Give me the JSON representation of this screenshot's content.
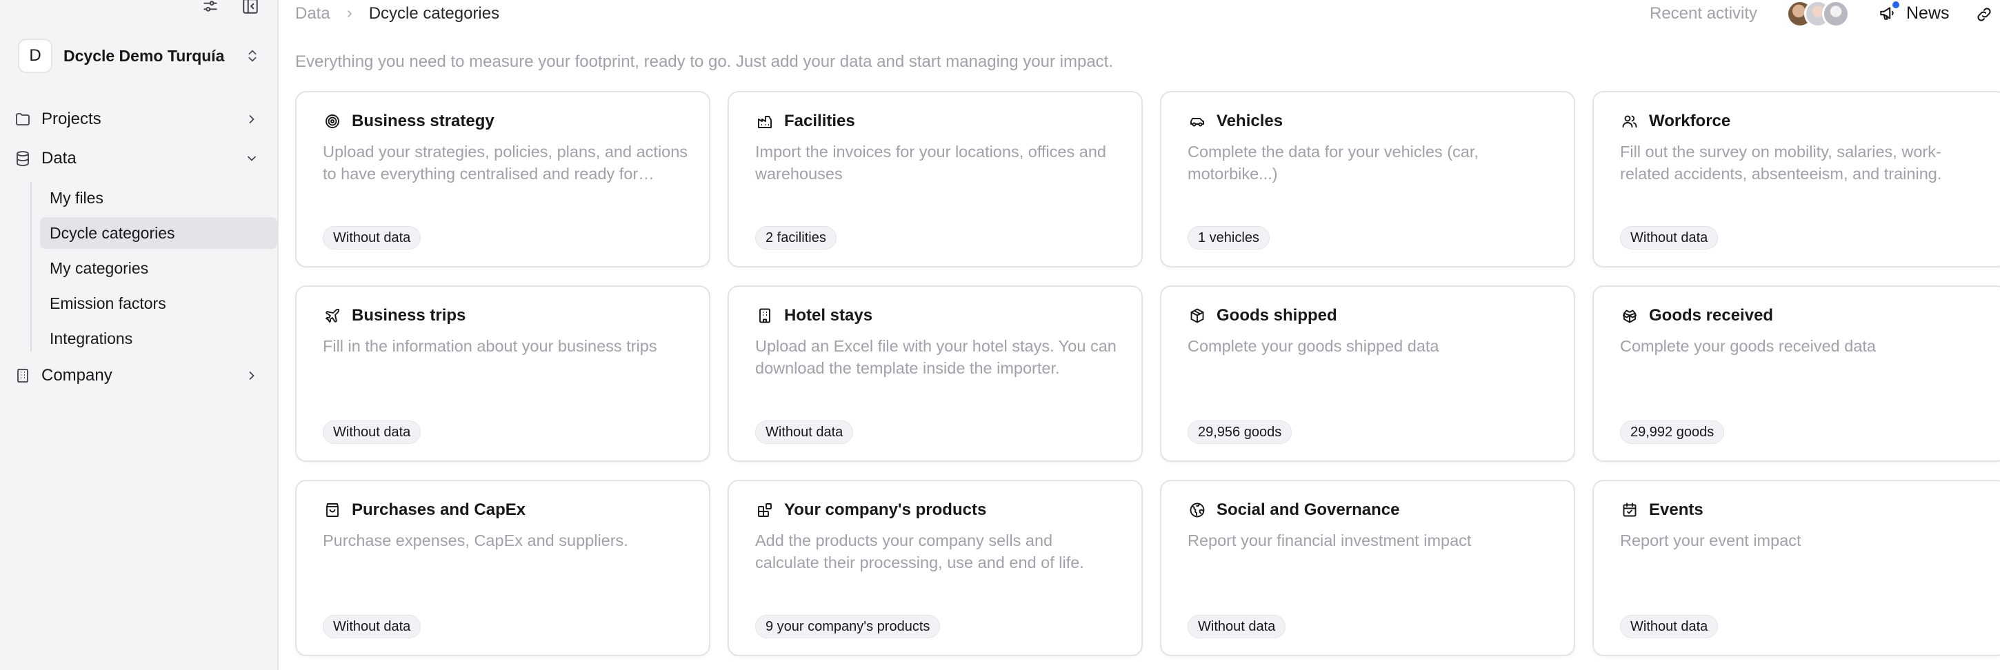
{
  "sidebar": {
    "org": {
      "initial": "D",
      "name": "Dcycle Demo Turquía"
    },
    "nav": [
      {
        "label": "Projects",
        "icon": "folder-icon"
      },
      {
        "label": "Data",
        "icon": "database-icon"
      },
      {
        "label": "Company",
        "icon": "building-icon"
      }
    ],
    "data_sub": [
      {
        "label": "My files",
        "active": false
      },
      {
        "label": "Dcycle categories",
        "active": true
      },
      {
        "label": "My categories",
        "active": false
      },
      {
        "label": "Emission factors",
        "active": false
      },
      {
        "label": "Integrations",
        "active": false
      }
    ]
  },
  "header": {
    "breadcrumb": [
      "Data",
      "Dcycle categories"
    ],
    "recent_activity": "Recent activity",
    "news": "News"
  },
  "main": {
    "subtitle": "Everything you need to measure your footprint, ready to go. Just add your data and start managing your impact.",
    "cards": [
      {
        "title": "Business strategy",
        "icon": "target-icon",
        "description": "Upload your strategies, policies, plans, and actions to have everything centralised and ready for reporting.",
        "badge": "Without data"
      },
      {
        "title": "Facilities",
        "icon": "factory-icon",
        "description": "Import the invoices for your locations, offices and warehouses",
        "badge": "2 facilities"
      },
      {
        "title": "Vehicles",
        "icon": "car-icon",
        "description": "Complete the data for your vehicles (car, motorbike...)",
        "badge": "1 vehicles"
      },
      {
        "title": "Workforce",
        "icon": "users-icon",
        "description": "Fill out the survey on mobility, salaries, work-related accidents, absenteeism, and training.",
        "badge": "Without data"
      },
      {
        "title": "Business trips",
        "icon": "plane-icon",
        "description": "Fill in the information about your business trips",
        "badge": "Without data"
      },
      {
        "title": "Hotel stays",
        "icon": "hotel-icon",
        "description": "Upload an Excel file with your hotel stays. You can download the template inside the importer.",
        "badge": "Without data"
      },
      {
        "title": "Goods shipped",
        "icon": "package-icon",
        "description": "Complete your goods shipped data",
        "badge": "29,956 goods"
      },
      {
        "title": "Goods received",
        "icon": "package-open-icon",
        "description": "Complete your goods received data",
        "badge": "29,992 goods"
      },
      {
        "title": "Purchases and CapEx",
        "icon": "shopping-bag-icon",
        "description": "Purchase expenses, CapEx and suppliers.",
        "badge": "Without data"
      },
      {
        "title": "Your company's products",
        "icon": "blocks-icon",
        "description": "Add the products your company sells and calculate their processing, use and end of life.",
        "badge": "9 your company's products"
      },
      {
        "title": "Social and Governance",
        "icon": "globe-icon",
        "description": "Report your financial investment impact",
        "badge": "Without data"
      },
      {
        "title": "Events",
        "icon": "calendar-icon",
        "description": "Report your event impact",
        "badge": "Without data"
      }
    ]
  }
}
